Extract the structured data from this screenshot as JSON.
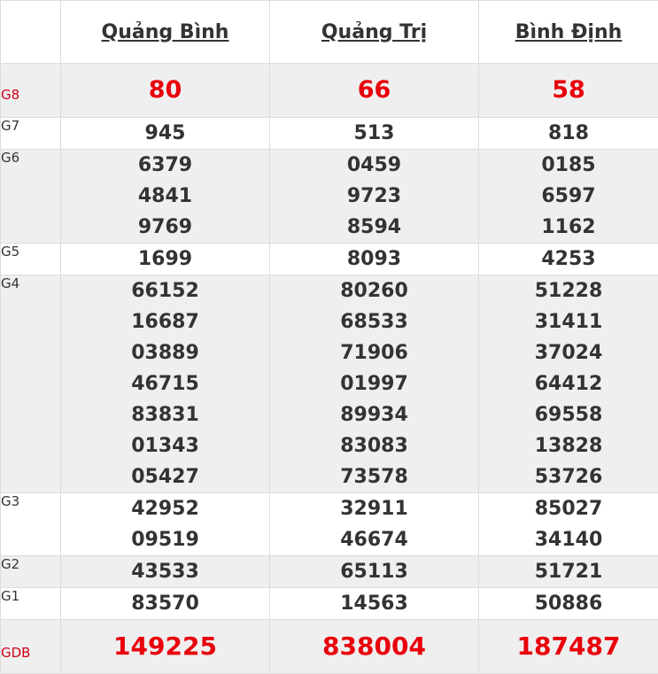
{
  "provinces": [
    "Quảng Bình",
    "Quảng Trị",
    "Bình Định"
  ],
  "prizes": [
    {
      "label": "G8",
      "red": true,
      "shade": true,
      "key": "g8",
      "values": [
        [
          "80"
        ],
        [
          "66"
        ],
        [
          "58"
        ]
      ]
    },
    {
      "label": "G7",
      "red": false,
      "shade": false,
      "key": "g7",
      "values": [
        [
          "945"
        ],
        [
          "513"
        ],
        [
          "818"
        ]
      ]
    },
    {
      "label": "G6",
      "red": false,
      "shade": true,
      "key": "g6",
      "values": [
        [
          "6379",
          "4841",
          "9769"
        ],
        [
          "0459",
          "9723",
          "8594"
        ],
        [
          "0185",
          "6597",
          "1162"
        ]
      ]
    },
    {
      "label": "G5",
      "red": false,
      "shade": false,
      "key": "g5",
      "values": [
        [
          "1699"
        ],
        [
          "8093"
        ],
        [
          "4253"
        ]
      ]
    },
    {
      "label": "G4",
      "red": false,
      "shade": true,
      "key": "g4",
      "values": [
        [
          "66152",
          "16687",
          "03889",
          "46715",
          "83831",
          "01343",
          "05427"
        ],
        [
          "80260",
          "68533",
          "71906",
          "01997",
          "89934",
          "83083",
          "73578"
        ],
        [
          "51228",
          "31411",
          "37024",
          "64412",
          "69558",
          "13828",
          "53726"
        ]
      ]
    },
    {
      "label": "G3",
      "red": false,
      "shade": false,
      "key": "g3",
      "values": [
        [
          "42952",
          "09519"
        ],
        [
          "32911",
          "46674"
        ],
        [
          "85027",
          "34140"
        ]
      ]
    },
    {
      "label": "G2",
      "red": false,
      "shade": true,
      "key": "g2",
      "values": [
        [
          "43533"
        ],
        [
          "65113"
        ],
        [
          "51721"
        ]
      ]
    },
    {
      "label": "G1",
      "red": false,
      "shade": false,
      "key": "g1",
      "values": [
        [
          "83570"
        ],
        [
          "14563"
        ],
        [
          "50886"
        ]
      ]
    },
    {
      "label": "GDB",
      "red": true,
      "shade": true,
      "key": "gdb",
      "values": [
        [
          "149225"
        ],
        [
          "838004"
        ],
        [
          "187487"
        ]
      ]
    }
  ]
}
